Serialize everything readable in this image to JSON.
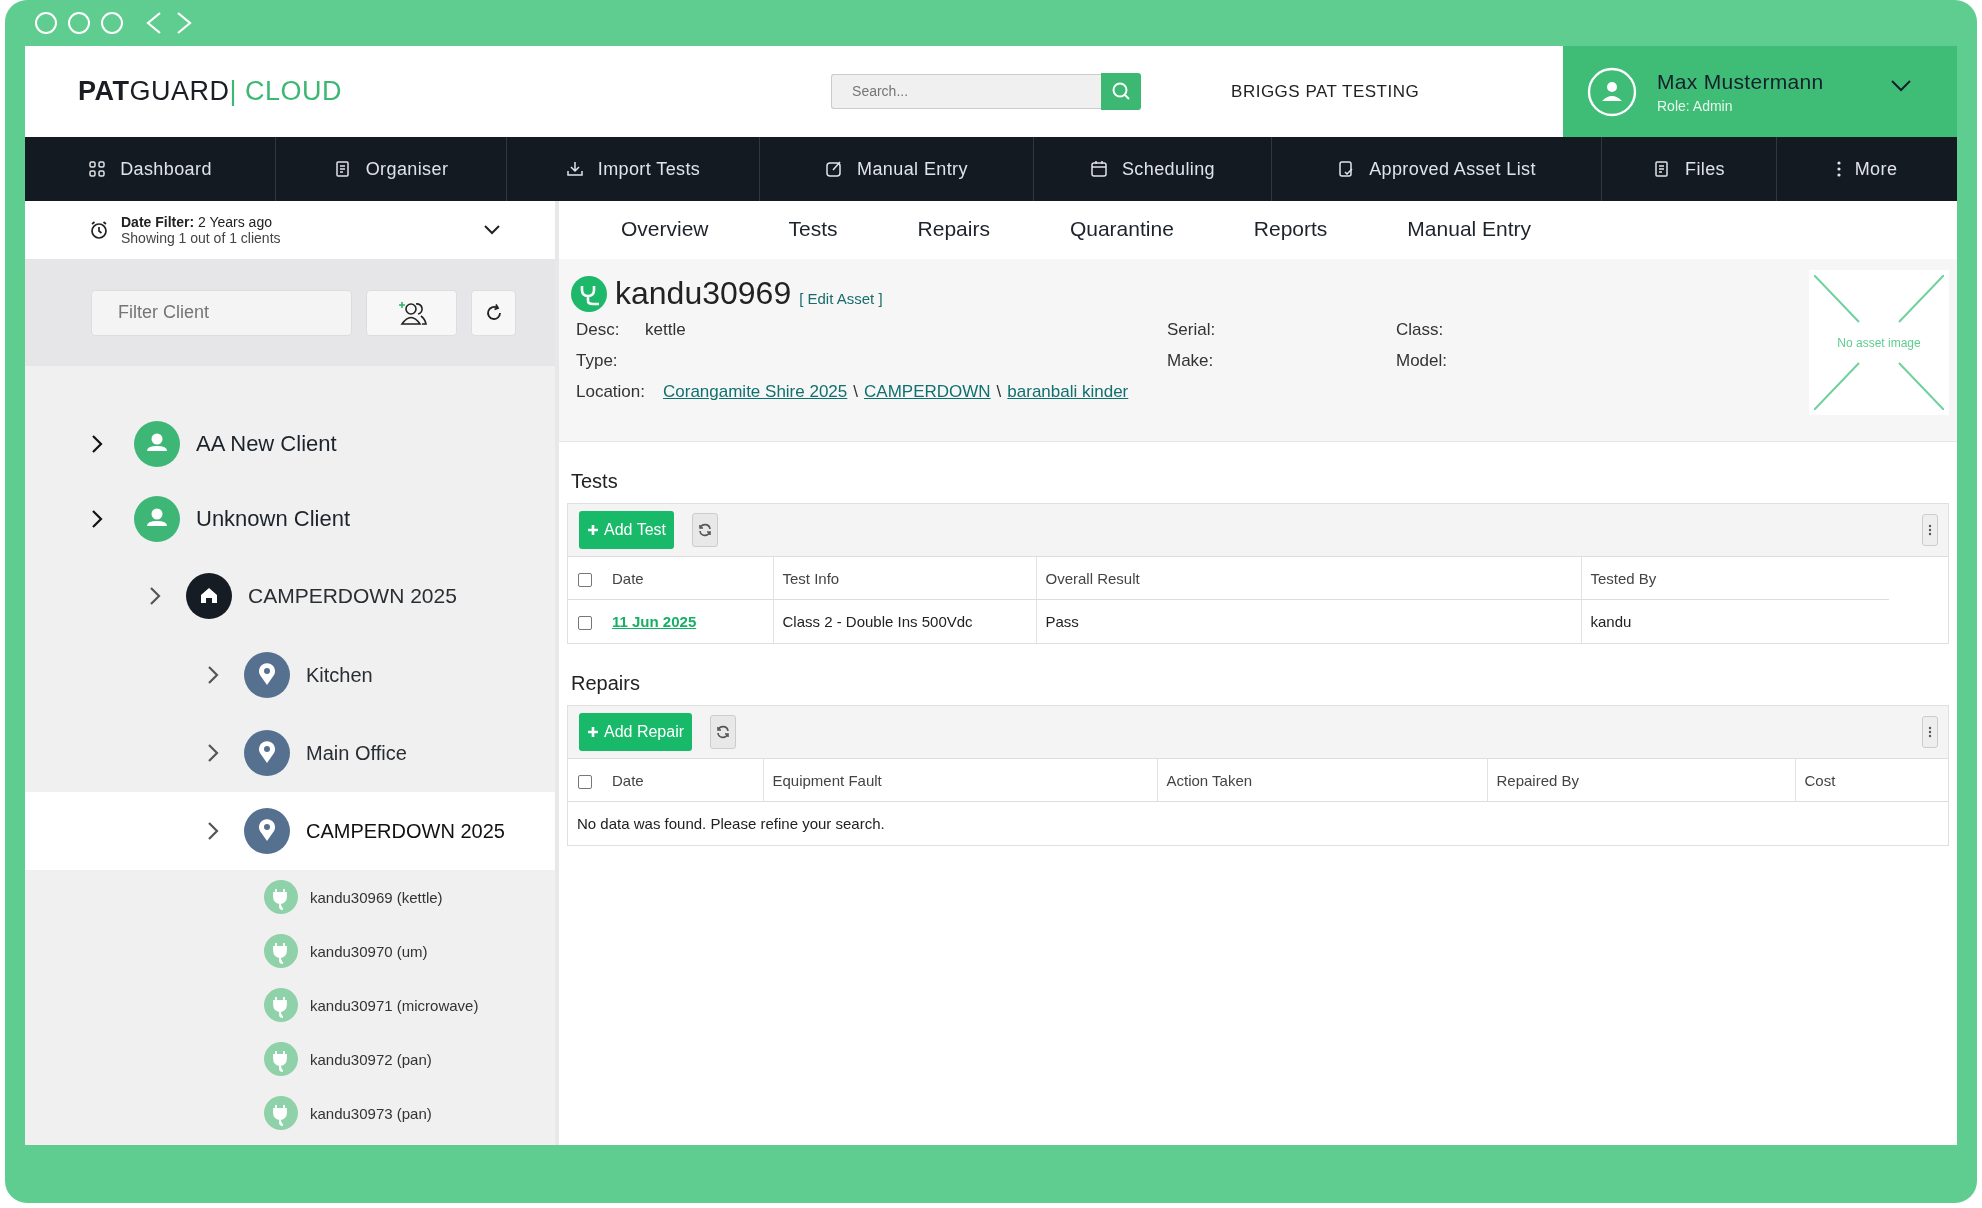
{
  "header": {
    "logo": {
      "bold": "PAT",
      "regular": "GUARD",
      "accent": "| CLOUD"
    },
    "search": {
      "placeholder": "Search..."
    },
    "company": "BRIGGS PAT TESTING",
    "user": {
      "name": "Max Mustermann",
      "role": "Role: Admin"
    }
  },
  "nav": [
    {
      "label": "Dashboard"
    },
    {
      "label": "Organiser"
    },
    {
      "label": "Import Tests"
    },
    {
      "label": "Manual Entry"
    },
    {
      "label": "Scheduling"
    },
    {
      "label": "Approved Asset List"
    },
    {
      "label": "Files"
    },
    {
      "label": "More"
    }
  ],
  "sidebar": {
    "date_filter": {
      "label": "Date Filter:",
      "value": "2 Years ago",
      "summary": "Showing 1 out of 1 clients"
    },
    "filter": {
      "placeholder": "Filter Client"
    },
    "tree": [
      {
        "label": "AA New Client",
        "kind": "client",
        "selected": false
      },
      {
        "label": "Unknown Client",
        "kind": "client",
        "selected": false,
        "children": [
          {
            "label": "CAMPERDOWN 2025",
            "kind": "site",
            "selected": false,
            "children": [
              {
                "label": "Kitchen",
                "kind": "location",
                "selected": false
              },
              {
                "label": "Main Office",
                "kind": "location",
                "selected": false
              },
              {
                "label": "CAMPERDOWN 2025",
                "kind": "location",
                "selected": true,
                "children": [
                  {
                    "label": "kandu30969 (kettle)",
                    "kind": "asset",
                    "selected": false
                  },
                  {
                    "label": "kandu30970 (um)",
                    "kind": "asset",
                    "selected": false
                  },
                  {
                    "label": "kandu30971 (microwave)",
                    "kind": "asset",
                    "selected": false
                  },
                  {
                    "label": "kandu30972 (pan)",
                    "kind": "asset",
                    "selected": false
                  },
                  {
                    "label": "kandu30973 (pan)",
                    "kind": "asset",
                    "selected": false
                  }
                ]
              }
            ]
          }
        ]
      }
    ]
  },
  "tabs": [
    {
      "label": "Overview",
      "selected": false
    },
    {
      "label": "Tests",
      "selected": false
    },
    {
      "label": "Repairs",
      "selected": false
    },
    {
      "label": "Quarantine",
      "selected": false
    },
    {
      "label": "Reports",
      "selected": false
    },
    {
      "label": "Manual Entry",
      "selected": false
    }
  ],
  "asset": {
    "id": "kandu30969",
    "edit_link": "[ Edit Asset ]",
    "fields": [
      {
        "label": "Desc:",
        "value": "kettle"
      },
      {
        "label": "Serial:"
      },
      {
        "label": "Class:"
      },
      {
        "label": "Type:"
      },
      {
        "label": "Make:"
      },
      {
        "label": "Model:"
      }
    ],
    "location": {
      "label": "Location:",
      "path": [
        {
          "text": "Corangamite Shire 2025",
          "kind": "link"
        },
        {
          "text": "\\",
          "kind": "separator"
        },
        {
          "text": "CAMPERDOWN",
          "kind": "link"
        },
        {
          "text": "\\",
          "kind": "separator"
        },
        {
          "text": "baranbali kinder",
          "kind": "link"
        }
      ]
    },
    "image_placeholder": "No asset image"
  },
  "tests": {
    "title": "Tests",
    "add_button": "Add Test",
    "header_checked": false,
    "columns": [
      "Date",
      "Test Info",
      "Overall Result",
      "Tested By"
    ],
    "rows": [
      {
        "checked": false,
        "cells": [
          "11 Jun 2025",
          "Class 2 - Double Ins 500Vdc",
          "Pass",
          "kandu"
        ]
      }
    ]
  },
  "repairs": {
    "title": "Repairs",
    "add_button": "Add Repair",
    "header_checked": false,
    "columns": [
      "Date",
      "Equipment Fault",
      "Action Taken",
      "Repaired By",
      "Cost"
    ],
    "empty_message": "No data was found. Please refine your search."
  }
}
